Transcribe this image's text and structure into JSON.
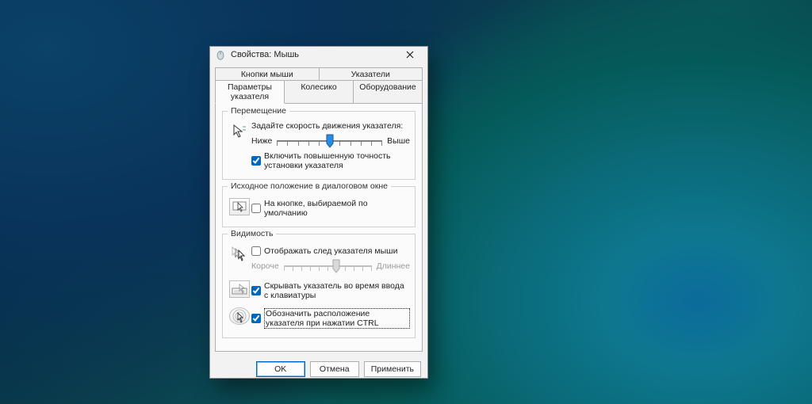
{
  "window": {
    "title": "Свойства: Мышь"
  },
  "tabs": {
    "row1": [
      "Кнопки мыши",
      "Указатели"
    ],
    "row2": [
      "Параметры указателя",
      "Колесико",
      "Оборудование"
    ],
    "active": "Параметры указателя"
  },
  "group_motion": {
    "legend": "Перемещение",
    "speed_label": "Задайте скорость движения указателя:",
    "slow": "Ниже",
    "fast": "Выше",
    "slider": {
      "min": 0,
      "max": 10,
      "value": 5
    },
    "precision_label": "Включить повышенную точность установки указателя",
    "precision_checked": true
  },
  "group_snapto": {
    "legend": "Исходное положение в диалоговом окне",
    "snap_label": "На кнопке, выбираемой по умолчанию",
    "snap_checked": false
  },
  "group_visibility": {
    "legend": "Видимость",
    "trails_label": "Отображать след указателя мыши",
    "trails_checked": false,
    "trails_short": "Короче",
    "trails_long": "Длиннее",
    "trails_slider": {
      "min": 0,
      "max": 10,
      "value": 6
    },
    "hide_typing_label": "Скрывать указатель во время ввода с клавиатуры",
    "hide_typing_checked": true,
    "ctrl_locate_label": "Обозначить расположение указателя при нажатии CTRL",
    "ctrl_locate_checked": true
  },
  "buttons": {
    "ok": "OK",
    "cancel": "Отмена",
    "apply": "Применить"
  }
}
